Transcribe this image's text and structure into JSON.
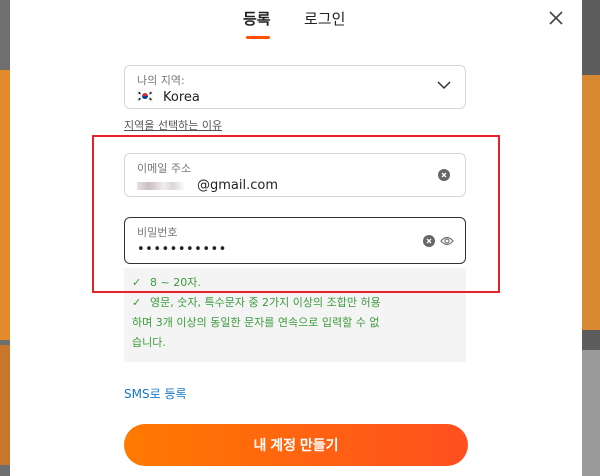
{
  "tabs": {
    "register": "등록",
    "login": "로그인"
  },
  "region": {
    "label": "나의 지역:",
    "value": "Korea",
    "why_link": "지역을 선택하는 이유"
  },
  "email": {
    "label": "이메일 주소",
    "value_suffix": "@gmail.com"
  },
  "password": {
    "label": "비밀번호",
    "value": "•••••••••••"
  },
  "rules": {
    "rule1": "8 ~ 20자.",
    "rule2_line1": "영문, 숫자, 특수문자 중 2가지 이상의 조합만 허용",
    "rule2_line2": "하며 3개 이상의 동일한 문자를 연속으로 입력할 수 없",
    "rule2_line3": "습니다."
  },
  "sms_link": "SMS로 등록",
  "create_button": "내 계정 만들기",
  "colors": {
    "accent": "#ff5000",
    "success": "#3c9a3c",
    "link": "#1677c9",
    "highlight": "#e4232a"
  },
  "icons": [
    "close-icon",
    "korea-flag-icon",
    "chevron-down-icon",
    "clear-icon",
    "eye-icon",
    "check-icon"
  ]
}
